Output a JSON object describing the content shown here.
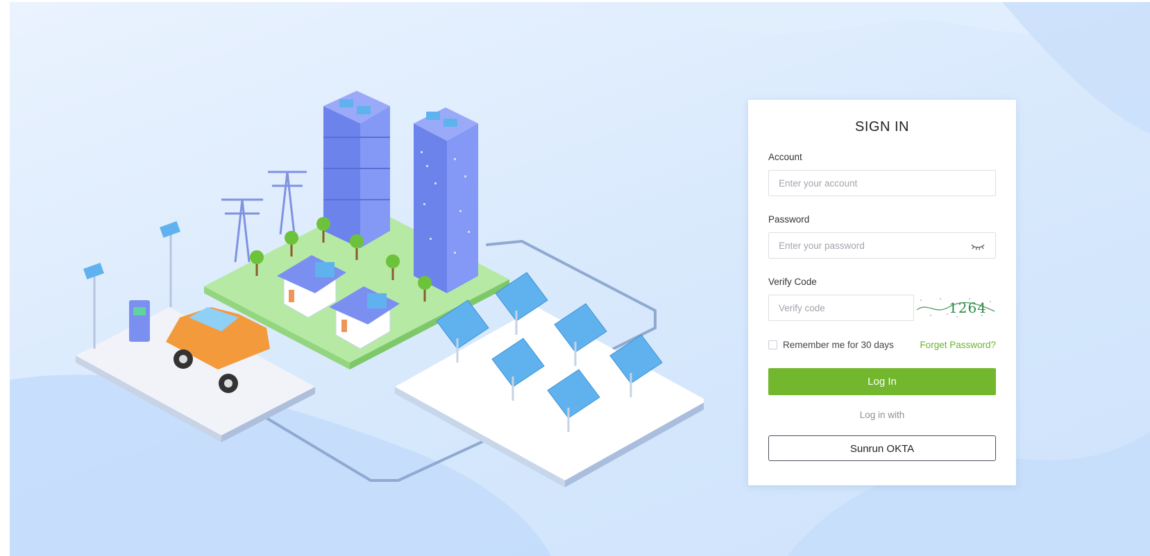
{
  "login": {
    "title": "SIGN IN",
    "account": {
      "label": "Account",
      "placeholder": "Enter your account",
      "value": ""
    },
    "password": {
      "label": "Password",
      "placeholder": "Enter your password",
      "value": "",
      "toggle_icon": "eye-closed-icon"
    },
    "verify": {
      "label": "Verify Code",
      "placeholder": "Verify code",
      "value": "",
      "captcha_text": "1264"
    },
    "remember_label": "Remember me for 30 days",
    "remember_checked": false,
    "forgot_label": "Forget Password?",
    "login_button": "Log In",
    "login_with": "Log in with",
    "sso_button": "Sunrun OKTA"
  },
  "colors": {
    "accent_green": "#72b72e",
    "link_green": "#6ab32c",
    "background_blue": "#d3e6fc"
  }
}
